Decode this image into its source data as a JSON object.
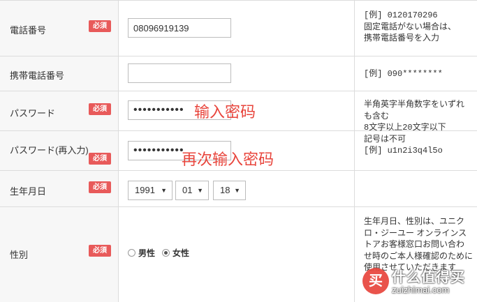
{
  "rows": {
    "phone": {
      "label": "電話番号",
      "required": "必須",
      "value": "08096919139",
      "note": "[例] 0120170296\n固定電話がない場合は、\n携帯電話番号を入力"
    },
    "mobile": {
      "label": "携帯電話番号",
      "value": "",
      "note": "[例] 090********"
    },
    "password": {
      "label": "パスワード",
      "required": "必須",
      "value": "•••••••••••",
      "annotation": "输入密码",
      "note": "半角英字半角数字をいずれ\nも含む\n8文字以上20文字以下\n記号は不可\n[例] u1n2i3q4l5o"
    },
    "password_confirm": {
      "label": "パスワード(再入力)",
      "required": "必須",
      "value": "•••••••••••",
      "annotation": "再次输入密码"
    },
    "birthday": {
      "label": "生年月日",
      "required": "必須",
      "year": "1991",
      "month": "01",
      "day": "18"
    },
    "gender": {
      "label": "性別",
      "required": "必須",
      "options": [
        "男性",
        "女性"
      ],
      "selected": "女性",
      "note": "生年月日、性別は、ユニク\nロ・ジーユー オンラインス\nトアお客様窓口お問い合わ\nせ時のご本人様確認のために\n使用させていただきます"
    }
  },
  "watermark": {
    "logo": "买",
    "title": "什么值得买",
    "url": "zuizhimai.com"
  },
  "colors": {
    "required_badge": "#e85a5a",
    "annotation": "#e8453c"
  }
}
